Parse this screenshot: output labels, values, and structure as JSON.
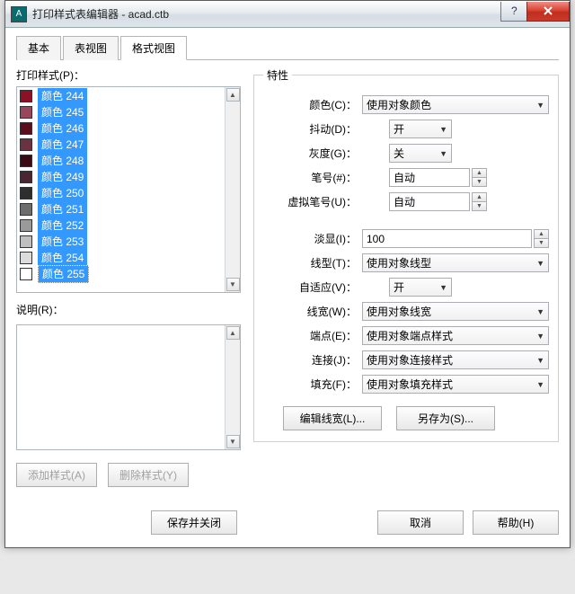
{
  "title": "打印样式表编辑器 - acad.ctb",
  "tabs": {
    "t1": "基本",
    "t2": "表视图",
    "t3": "格式视图"
  },
  "left": {
    "list_label": "打印样式(P)：",
    "desc_label": "说明(R)：",
    "items": [
      {
        "label": "颜色 244",
        "color": "#8c1127"
      },
      {
        "label": "颜色 245",
        "color": "#97485c"
      },
      {
        "label": "颜色 246",
        "color": "#5b0e1e"
      },
      {
        "label": "颜色 247",
        "color": "#6b3241"
      },
      {
        "label": "颜色 248",
        "color": "#3b0a15"
      },
      {
        "label": "颜色 249",
        "color": "#4a2532"
      },
      {
        "label": "颜色 250",
        "color": "#2e2e2e"
      },
      {
        "label": "颜色 251",
        "color": "#6d6d6d"
      },
      {
        "label": "颜色 252",
        "color": "#9a9a9a"
      },
      {
        "label": "颜色 253",
        "color": "#bfbfbf"
      },
      {
        "label": "颜色 254",
        "color": "#dcdcdc"
      },
      {
        "label": "颜色 255",
        "color": "#ffffff"
      }
    ],
    "add_btn": "添加样式(A)",
    "del_btn": "删除样式(Y)"
  },
  "props": {
    "legend": "特性",
    "color_l": "颜色(C)：",
    "color_v": "使用对象颜色",
    "dither_l": "抖动(D)：",
    "dither_v": "开",
    "gray_l": "灰度(G)：",
    "gray_v": "关",
    "pen_l": "笔号(#)：",
    "pen_v": "自动",
    "vpen_l": "虚拟笔号(U)：",
    "vpen_v": "自动",
    "screen_l": "淡显(I)：",
    "screen_v": "100",
    "ltype_l": "线型(T)：",
    "ltype_v": "使用对象线型",
    "adapt_l": "自适应(V)：",
    "adapt_v": "开",
    "lw_l": "线宽(W)：",
    "lw_v": "使用对象线宽",
    "end_l": "端点(E)：",
    "end_v": "使用对象端点样式",
    "join_l": "连接(J)：",
    "join_v": "使用对象连接样式",
    "fill_l": "填充(F)：",
    "fill_v": "使用对象填充样式",
    "editlw_btn": "编辑线宽(L)...",
    "saveas_btn": "另存为(S)..."
  },
  "footer": {
    "save": "保存并关闭",
    "cancel": "取消",
    "help": "帮助(H)"
  }
}
